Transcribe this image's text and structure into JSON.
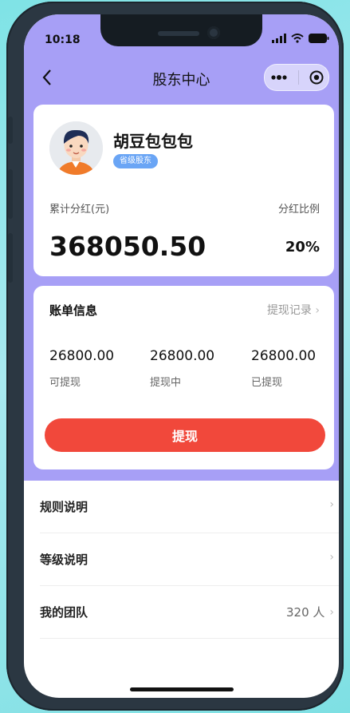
{
  "status": {
    "time": "10:18"
  },
  "nav": {
    "title": "股东中心",
    "back_icon": "chevron-left-icon",
    "more_icon": "more-dots-icon",
    "close_icon": "target-circle-icon"
  },
  "profile": {
    "name": "胡豆包包包",
    "badge": "省级股东",
    "cumulative_label": "累计分红(元)",
    "cumulative_value": "368050.50",
    "ratio_label": "分红比例",
    "ratio_value": "20%"
  },
  "bill": {
    "title": "账单信息",
    "link": "提现记录",
    "items": [
      {
        "value": "26800.00",
        "label": "可提现"
      },
      {
        "value": "26800.00",
        "label": "提现中"
      },
      {
        "value": "26800.00",
        "label": "已提现"
      }
    ],
    "withdraw_button": "提现"
  },
  "list": [
    {
      "label": "规则说明",
      "right": ""
    },
    {
      "label": "等级说明",
      "right": ""
    },
    {
      "label": "我的团队",
      "right": "320 人"
    }
  ],
  "colors": {
    "header": "#a79ff6",
    "primary_button": "#f1483b",
    "badge": "#6aa5f5"
  }
}
